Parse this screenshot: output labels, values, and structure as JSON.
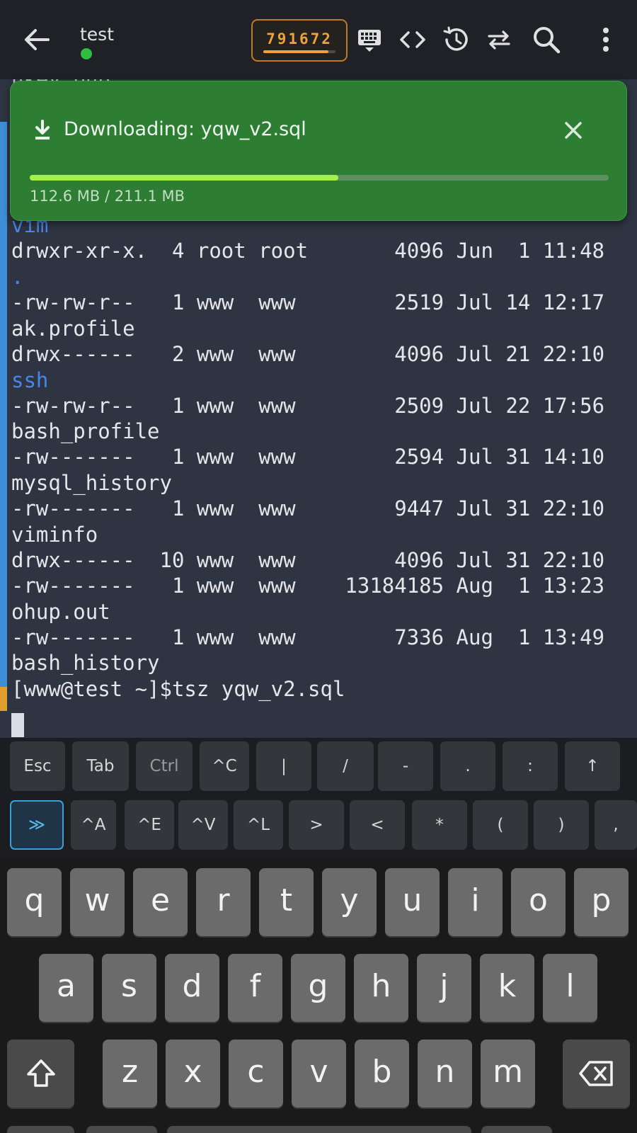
{
  "topbar": {
    "host": "test",
    "session_code": "791672",
    "session_code_progress": 0.9,
    "icons": [
      "back-arrow-icon",
      "keyboard-icon",
      "code-icon",
      "history-icon",
      "swap-icon",
      "search-icon",
      "more-vert-icon"
    ]
  },
  "download": {
    "title": "Downloading: yqw_v2.sql",
    "size_text": "112.6 MB / 211.1 MB",
    "progress": 0.533
  },
  "terminal": {
    "lines": [
      {
        "text": "nkey.pub",
        "type": "file"
      },
      {
        "text": "vim",
        "type": "dir"
      },
      {
        "text": "drwxr-xr-x.  4 root root       4096 Jun  1 11:48",
        "type": "file"
      },
      {
        "text": ".",
        "type": "dir"
      },
      {
        "text": "-rw-rw-r--   1 www  www        2519 Jul 14 12:17",
        "type": "file"
      },
      {
        "text": "ak.profile",
        "type": "file"
      },
      {
        "text": "drwx------   2 www  www        4096 Jul 21 22:10",
        "type": "file"
      },
      {
        "text": "ssh",
        "type": "dir"
      },
      {
        "text": "-rw-rw-r--   1 www  www        2509 Jul 22 17:56",
        "type": "file"
      },
      {
        "text": "bash_profile",
        "type": "file"
      },
      {
        "text": "-rw-------   1 www  www        2594 Jul 31 14:10",
        "type": "file"
      },
      {
        "text": "mysql_history",
        "type": "file"
      },
      {
        "text": "-rw-------   1 www  www        9447 Jul 31 22:10",
        "type": "file"
      },
      {
        "text": "viminfo",
        "type": "file"
      },
      {
        "text": "drwx------  10 www  www        4096 Jul 31 22:10",
        "type": "file"
      },
      {
        "text": "-rw-------   1 www  www    13184185 Aug  1 13:23",
        "type": "file"
      },
      {
        "text": "ohup.out",
        "type": "file"
      },
      {
        "text": "-rw-------   1 www  www        7336 Aug  1 13:49",
        "type": "file"
      },
      {
        "text": "bash_history",
        "type": "file"
      },
      {
        "text": "[www@test ~]$tsz yqw_v2.sql",
        "type": "prompt"
      }
    ]
  },
  "extra_keys": {
    "row1": [
      "Esc",
      "Tab",
      "Ctrl",
      "^C",
      "|",
      "/",
      "-",
      ".",
      ":",
      "↑"
    ],
    "row2": [
      "≫",
      "^A",
      "^E",
      "^V",
      "^L",
      ">",
      "<",
      "*",
      "(",
      ")",
      ","
    ]
  },
  "keyboard": {
    "row1": [
      "q",
      "w",
      "e",
      "r",
      "t",
      "y",
      "u",
      "i",
      "o",
      "p"
    ],
    "row2": [
      "a",
      "s",
      "d",
      "f",
      "g",
      "h",
      "j",
      "k",
      "l"
    ],
    "row3": [
      "z",
      "x",
      "c",
      "v",
      "b",
      "n",
      "m"
    ]
  },
  "colors": {
    "banner_bg": "#2d7d33",
    "progress_fill": "#a6f04a",
    "code_accent": "#f0a13a",
    "terminal_bg": "#2e3441",
    "dir_blue": "#4a86e8"
  }
}
